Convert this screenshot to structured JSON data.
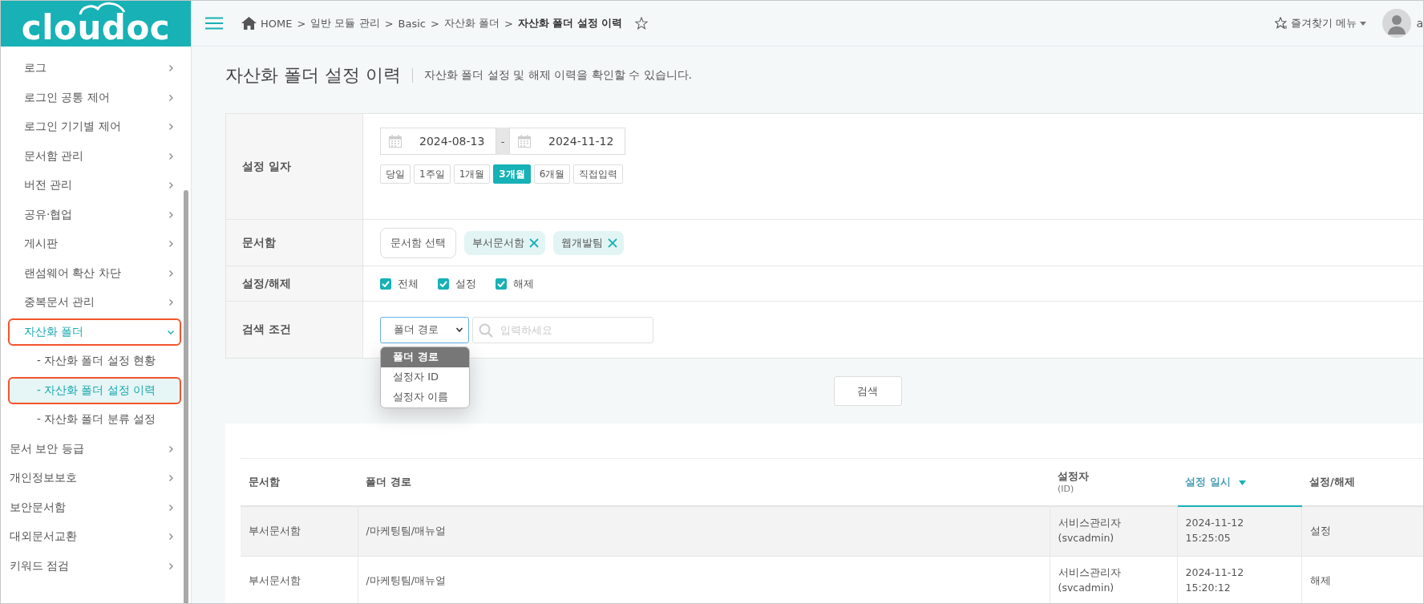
{
  "logo": {
    "text": "cloudoc"
  },
  "sidebar": {
    "items": [
      {
        "children": [
          {
            "label": "로그",
            "expanded": false,
            "selected": false,
            "highlighted": false
          },
          {
            "label": "로그인 공통 제어",
            "expanded": false,
            "selected": false,
            "highlighted": false
          },
          {
            "label": "로그인 기기별 제어",
            "expanded": false,
            "selected": false,
            "highlighted": false
          },
          {
            "label": "문서함 관리",
            "expanded": false,
            "selected": false,
            "highlighted": false
          },
          {
            "label": "버전 관리",
            "expanded": false,
            "selected": false,
            "highlighted": false
          },
          {
            "label": "공유·협업",
            "expanded": false,
            "selected": false,
            "highlighted": false
          },
          {
            "label": "게시판",
            "expanded": false,
            "selected": false,
            "highlighted": false
          },
          {
            "label": "랜섬웨어 확산 차단",
            "expanded": false,
            "selected": false,
            "highlighted": false
          },
          {
            "label": "중복문서 관리",
            "expanded": false,
            "selected": false,
            "highlighted": false
          },
          {
            "label": "자산화 폴더",
            "expanded": true,
            "selected": true,
            "highlighted": true,
            "children": [
              {
                "label": "- 자산화 폴더 설정 현황",
                "selected": false,
                "highlighted": false
              },
              {
                "label": "- 자산화 폴더 설정 이력",
                "selected": true,
                "highlighted": true
              },
              {
                "label": "- 자산화 폴더 분류 설정",
                "selected": false,
                "highlighted": false
              }
            ]
          }
        ]
      },
      {
        "label": "문서 보안 등급",
        "expanded": false,
        "selected": false,
        "highlighted": false
      },
      {
        "label": "개인정보보호",
        "expanded": false,
        "selected": false,
        "highlighted": false
      },
      {
        "label": "보안문서함",
        "expanded": false,
        "selected": false,
        "highlighted": false
      },
      {
        "label": "대외문서교환",
        "expanded": false,
        "selected": false,
        "highlighted": false
      },
      {
        "label": "키워드 점검",
        "expanded": false,
        "selected": false,
        "highlighted": false
      }
    ]
  },
  "topbar": {
    "breadcrumb": [
      {
        "label": "HOME",
        "current": false
      },
      {
        "separator": ">",
        "label": "일반 모듈 관리",
        "current": false
      },
      {
        "separator": ">",
        "label": "Basic",
        "current": false
      },
      {
        "separator": ">",
        "label": "자산화 폴더",
        "current": false
      },
      {
        "separator": ">",
        "label": "자산화 폴더 설정 이력",
        "current": true
      }
    ],
    "favorites_menu": "즐겨찾기 메뉴",
    "user_name": "a"
  },
  "page": {
    "title": "자산화 폴더 설정 이력",
    "description": "자산화 폴더 설정 및 해제 이력을 확인할 수 있습니다."
  },
  "filter": {
    "date": {
      "label": "설정 일자",
      "start": "2024-08-13",
      "separator": "-",
      "end": "2024-11-12",
      "presets": [
        {
          "label": "당일",
          "selected": false
        },
        {
          "label": "1주일",
          "selected": false
        },
        {
          "label": "1개월",
          "selected": false
        },
        {
          "label": "3개월",
          "selected": true
        },
        {
          "label": "6개월",
          "selected": false
        },
        {
          "label": "직접입력",
          "selected": false
        }
      ]
    },
    "folder_box": {
      "label": "문서함",
      "button": "문서함 선택",
      "tags": [
        {
          "label": "부서문서함"
        },
        {
          "label": "웹개발팀"
        }
      ]
    },
    "status": {
      "label": "설정/해제",
      "options": [
        {
          "label": "전체",
          "checked": true
        },
        {
          "label": "설정",
          "checked": true
        },
        {
          "label": "해제",
          "checked": true
        }
      ]
    },
    "condition": {
      "label": "검색 조건",
      "select": {
        "value": "폴더 경로",
        "expanded": true,
        "options": [
          {
            "label": "폴더 경로",
            "selected": true
          },
          {
            "label": "설정자 ID",
            "selected": false
          },
          {
            "label": "설정자 이름",
            "selected": false
          }
        ]
      },
      "search": {
        "placeholder": "입력하세요"
      }
    },
    "search_button": "검색"
  },
  "table": {
    "columns": [
      {
        "label": "문서함",
        "sorted": false
      },
      {
        "label": "폴더 경로",
        "sorted": false
      },
      {
        "label": "설정자",
        "sublabel": "(ID)",
        "sorted": false
      },
      {
        "label": "설정 일시",
        "sorted": true
      },
      {
        "label": "설정/해제",
        "sorted": false
      }
    ],
    "rows": [
      {
        "selected": true,
        "cells": [
          "부서문서함",
          "/마케팅팀/매뉴얼",
          [
            "서비스관리자",
            "(svcadmin)"
          ],
          [
            "2024-11-12",
            "15:25:05"
          ],
          "설정"
        ]
      },
      {
        "selected": false,
        "cells": [
          "부서문서함",
          "/마케팅팀/매뉴얼",
          [
            "서비스관리자",
            "(svcadmin)"
          ],
          [
            "2024-11-12",
            "15:20:12"
          ],
          "해제"
        ]
      }
    ]
  }
}
